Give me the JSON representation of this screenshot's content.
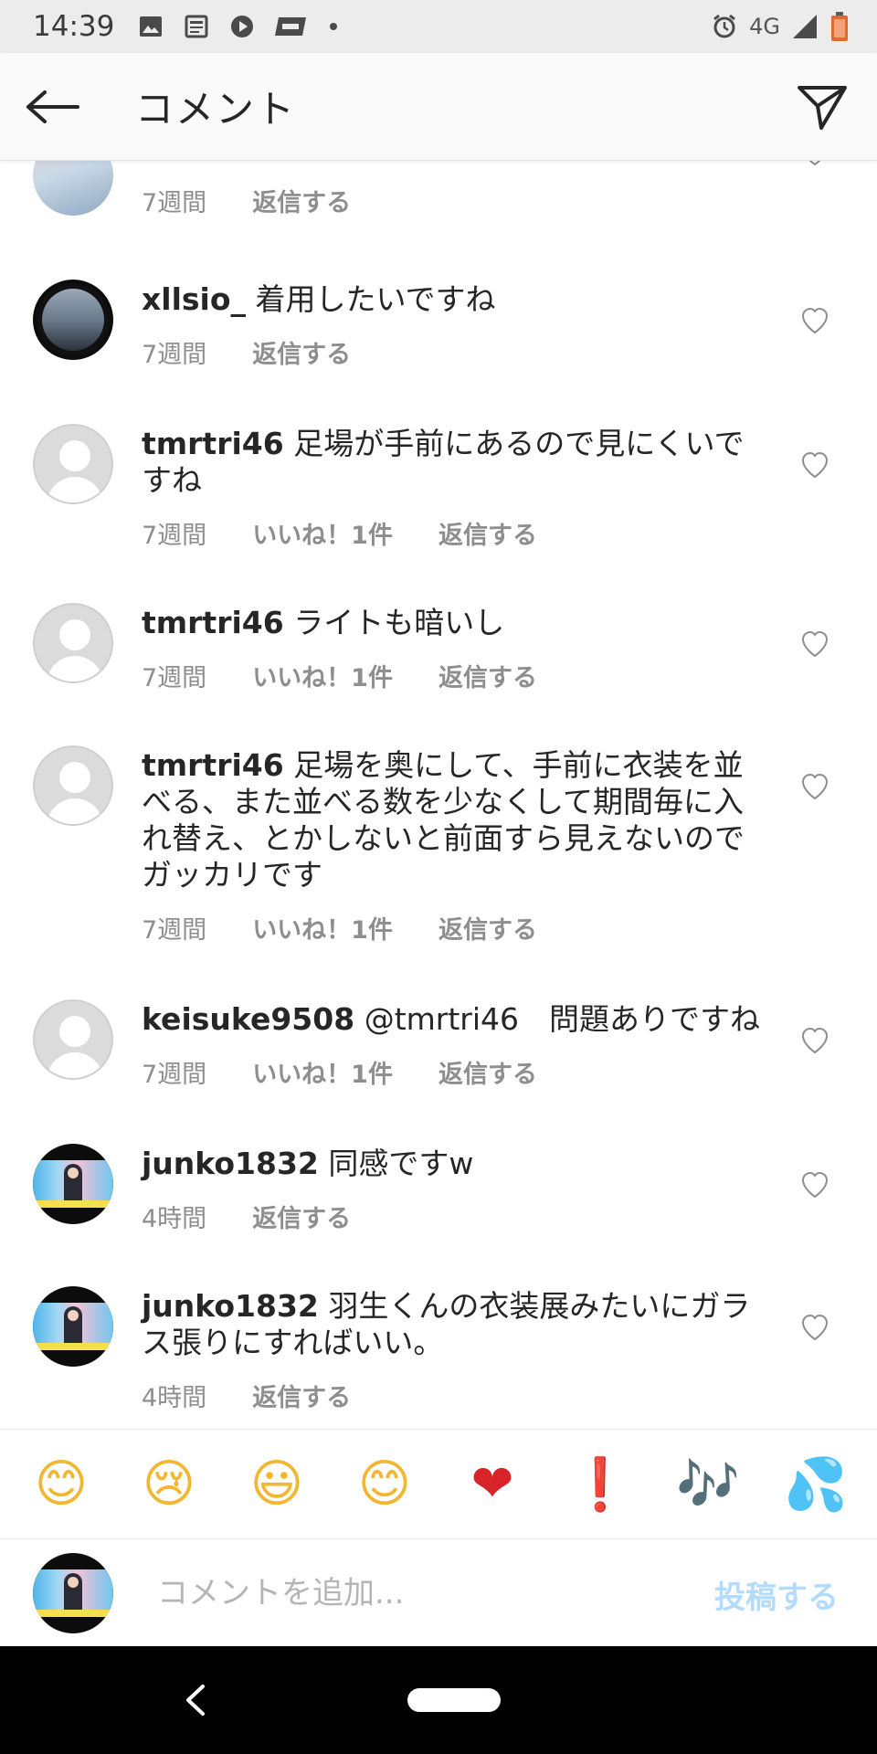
{
  "status_bar": {
    "time": "14:39",
    "network": "4G",
    "icons": [
      "image-icon",
      "news-icon",
      "play-icon",
      "tss-icon",
      "dot-icon",
      "alarm-icon",
      "signal-icon",
      "battery-icon"
    ]
  },
  "header": {
    "title": "コメント",
    "back_icon": "back-arrow-icon",
    "send_icon": "send-icon"
  },
  "comments": [
    {
      "username": "",
      "text": "",
      "time": "7週間",
      "likes": "",
      "reply": "返信する",
      "avatar": "photo"
    },
    {
      "username": "xllsio_",
      "text": "着用したいですね",
      "time": "7週間",
      "likes": "",
      "reply": "返信する",
      "avatar": "photo"
    },
    {
      "username": "tmrtri46",
      "text": "足場が手前にあるので見にくいですね",
      "time": "7週間",
      "likes": "いいね！1件",
      "reply": "返信する",
      "avatar": "default"
    },
    {
      "username": "tmrtri46",
      "text": "ライトも暗いし",
      "time": "7週間",
      "likes": "いいね！1件",
      "reply": "返信する",
      "avatar": "default"
    },
    {
      "username": "tmrtri46",
      "text": "足場を奥にして、手前に衣装を並べる、また並べる数を少なくして期間毎に入れ替え、とかしないと前面すら見えないのでガッカリです",
      "time": "7週間",
      "likes": "いいね！1件",
      "reply": "返信する",
      "avatar": "default"
    },
    {
      "username": "keisuke9508",
      "text": "@tmrtri46　問題ありですね",
      "time": "7週間",
      "likes": "いいね！1件",
      "reply": "返信する",
      "avatar": "default"
    },
    {
      "username": "junko1832",
      "text": "同感ですw",
      "time": "4時間",
      "likes": "",
      "reply": "返信する",
      "avatar": "photo"
    },
    {
      "username": "junko1832",
      "text": "羽生くんの衣装展みたいにガラス張りにすればいい。",
      "time": "4時間",
      "likes": "",
      "reply": "返信する",
      "avatar": "photo"
    }
  ],
  "emoji_bar": [
    "😊",
    "😢",
    "😃",
    "😊",
    "❤",
    "❗",
    "🎶",
    "💦"
  ],
  "input": {
    "placeholder": "コメントを追加...",
    "post_label": "投稿する"
  },
  "nav_bar": {
    "icons": [
      "nav-back-icon",
      "home-pill-icon"
    ]
  },
  "colors": {
    "status_bar_bg": "#ececec",
    "header_bg": "#fafafa",
    "meta_text": "#8e8e8e",
    "post_button": "#b3dbff",
    "nav_bar_bg": "#000000"
  }
}
